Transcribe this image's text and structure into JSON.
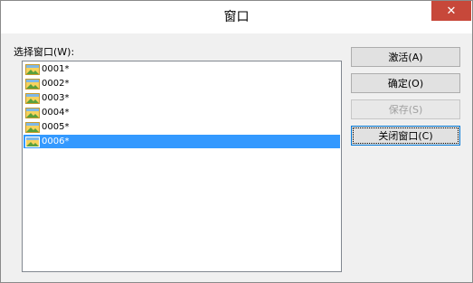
{
  "window": {
    "title": "窗口",
    "close_label": "✕"
  },
  "list": {
    "label": "选择窗口(W):",
    "items": [
      "0001*",
      "0002*",
      "0003*",
      "0004*",
      "0005*",
      "0006*"
    ],
    "selected_index": 5
  },
  "buttons": {
    "activate": "激活(A)",
    "ok": "确定(O)",
    "save": "保存(S)",
    "close_window": "关闭窗口(C)"
  },
  "icons": {
    "item_icon": "image-window-icon",
    "close_icon": "close-icon"
  },
  "colors": {
    "selection": "#3399ff",
    "close_button": "#c7483a"
  }
}
